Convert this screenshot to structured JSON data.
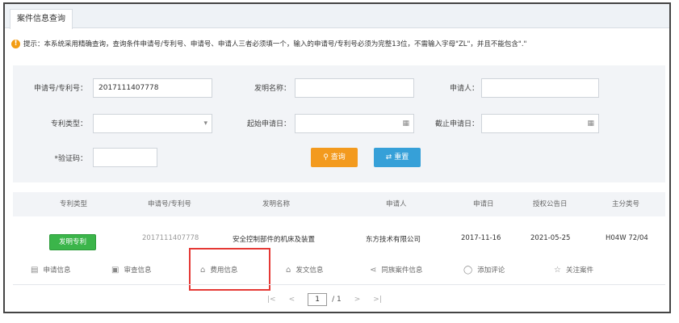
{
  "tab": {
    "title": "案件信息查询"
  },
  "notice": {
    "icon": "warning-icon",
    "text": "提示：本系统采用精确查询，查询条件申请号/专利号、申请号、申请人三者必须填一个，输入的申请号/专利号必须为完整13位，不需输入字母\"ZL\"，并且不能包含\".\""
  },
  "form": {
    "appno_label": "申请号/专利号：",
    "appno_value": "2017111407778",
    "invention_label": "发明名称：",
    "invention_value": "",
    "applicant_label": "申请人：",
    "applicant_value": "",
    "type_label": "专利类型：",
    "type_value": "",
    "start_label": "起始申请日：",
    "start_value": "",
    "end_label": "截止申请日：",
    "end_value": "",
    "captcha_label": "*验证码：",
    "captcha_value": "",
    "query_label": "查询",
    "reset_label": "重置"
  },
  "table": {
    "headers": [
      "专利类型",
      "申请号/专利号",
      "发明名称",
      "申请人",
      "申请日",
      "授权公告日",
      "主分类号"
    ],
    "rows": [
      {
        "type": "发明专利",
        "appno": "2017111407778",
        "name": "安全控制部件的机床及装置",
        "applicant": "东方技术有限公司",
        "apply_date": "2017-11-16",
        "grant_date": "2021-05-25",
        "class": "H04W 72/04"
      }
    ]
  },
  "actions": [
    {
      "label": "申请信息",
      "icon": "document-icon"
    },
    {
      "label": "审查信息",
      "icon": "image-icon"
    },
    {
      "label": "费用信息",
      "icon": "receipt-icon"
    },
    {
      "label": "发文信息",
      "icon": "receipt-icon"
    },
    {
      "label": "同族案件信息",
      "icon": "share-icon"
    },
    {
      "label": "添加评论",
      "icon": "comment-icon"
    },
    {
      "label": "关注案件",
      "icon": "star-icon"
    }
  ],
  "pager": {
    "first": "|<",
    "prev": "<",
    "current": "1",
    "total": "/ 1",
    "next": ">",
    "last": ">|"
  }
}
